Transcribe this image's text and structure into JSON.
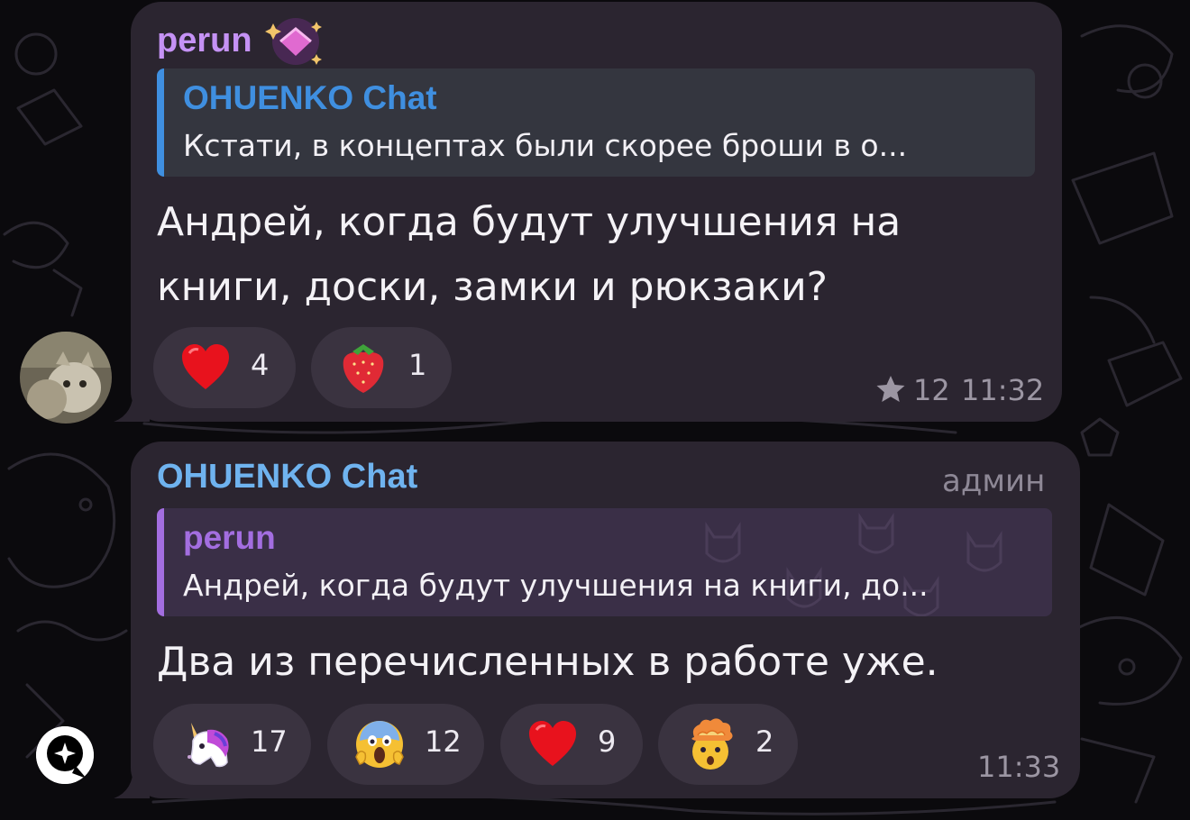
{
  "messages": [
    {
      "sender": "perun",
      "sender_color": "#c592f5",
      "reply": {
        "name": "OHUENKO Chat",
        "text": "Кстати, в концептах были скорее броши в о...",
        "accent": "#3f8fe0"
      },
      "text_line1": "Андрей, когда будут улучшения на",
      "text_line2": "книги, доски, замки и рюкзаки?",
      "reactions": [
        {
          "emoji": "heart",
          "count": "4"
        },
        {
          "emoji": "strawberry",
          "count": "1"
        }
      ],
      "views": "12",
      "time": "11:32"
    },
    {
      "sender": "OHUENKO Chat",
      "sender_color": "#6fb3ef",
      "role": "админ",
      "reply": {
        "name": "perun",
        "text": "Андрей, когда будут улучшения на книги, до...",
        "accent": "#a36ee0"
      },
      "text": "Два из перечисленных в работе уже.",
      "reactions": [
        {
          "emoji": "unicorn",
          "count": "17"
        },
        {
          "emoji": "scream",
          "count": "12"
        },
        {
          "emoji": "heart",
          "count": "9"
        },
        {
          "emoji": "exploding-head",
          "count": "2"
        }
      ],
      "time": "11:33"
    }
  ],
  "colors": {
    "background": "#0b0a0d",
    "bubble": "#2b2530",
    "reaction_pill": "#3a3340",
    "meta_text": "#9c96a3"
  }
}
